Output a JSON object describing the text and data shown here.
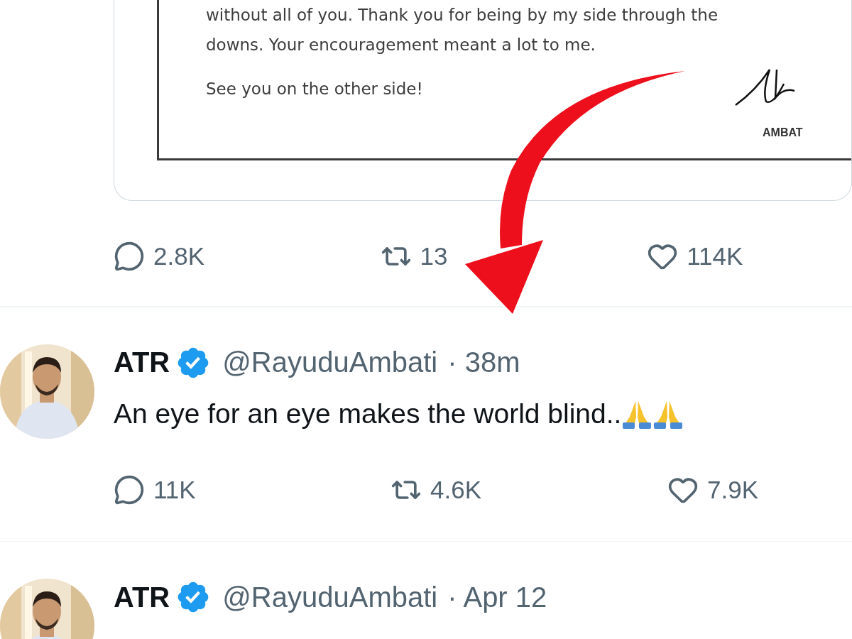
{
  "letter": {
    "lines": [
      "without all of you. Thank you for being by my side through the",
      "downs. Your encouragement meant a lot to me."
    ],
    "closing": "See you on the other side!",
    "signature_name": "AMBAT"
  },
  "letter_actions": {
    "replies": "2.8K",
    "retweets": "13",
    "likes": "114K"
  },
  "tweets": [
    {
      "name": "ATR",
      "verified": true,
      "handle": "@RayuduAmbati",
      "time": "· 38m",
      "text": "An eye for an eye makes the world blind..",
      "emoji": [
        {
          "kind": "folded-hands"
        },
        {
          "kind": "folded-hands"
        }
      ],
      "replies": "11K",
      "retweets": "4.6K",
      "likes": "7.9K"
    },
    {
      "name": "ATR",
      "verified": true,
      "handle": "@RayuduAmbati",
      "time": "· Apr 12"
    }
  ]
}
